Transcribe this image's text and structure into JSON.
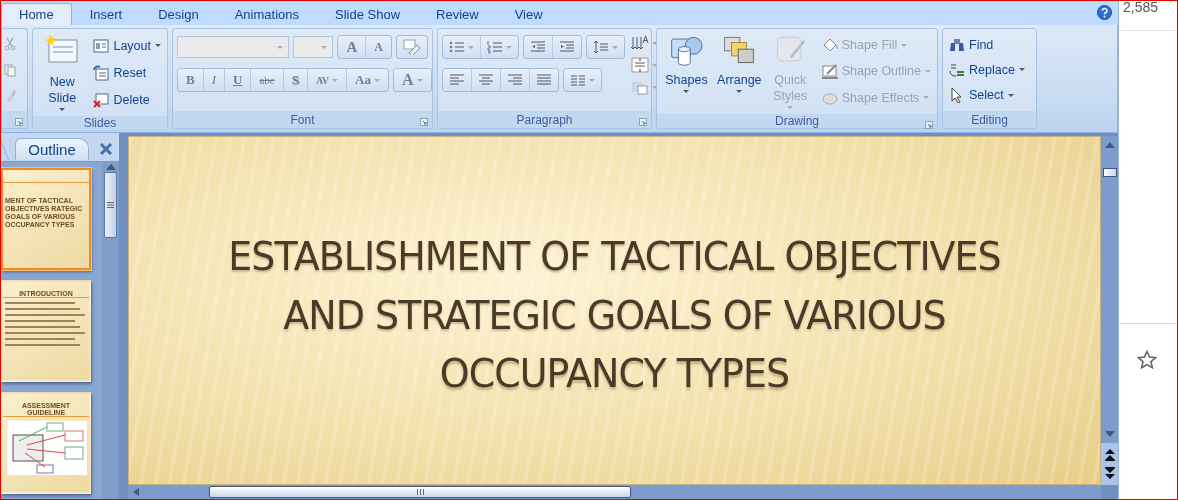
{
  "ribbon_tabs": [
    {
      "label": "Home",
      "selected": true
    },
    {
      "label": "Insert",
      "selected": false
    },
    {
      "label": "Design",
      "selected": false
    },
    {
      "label": "Animations",
      "selected": false
    },
    {
      "label": "Slide Show",
      "selected": false
    },
    {
      "label": "Review",
      "selected": false
    },
    {
      "label": "View",
      "selected": false
    }
  ],
  "slides_group": {
    "label": "Slides",
    "new_slide": "New Slide",
    "commands": [
      "Layout",
      "Reset",
      "Delete"
    ]
  },
  "font_group": {
    "label": "Font",
    "size_buttons": [
      "A",
      "A"
    ],
    "format_buttons": [
      {
        "kind": "bold",
        "label": "B"
      },
      {
        "kind": "italic",
        "label": "I"
      },
      {
        "kind": "underline",
        "label": "U"
      },
      {
        "kind": "strike",
        "label": "abc"
      },
      {
        "kind": "shadow",
        "label": "S"
      },
      {
        "kind": "spacing",
        "label": "AV"
      },
      {
        "kind": "case",
        "label": "Aa"
      }
    ],
    "color_button": "A"
  },
  "paragraph_group": {
    "label": "Paragraph"
  },
  "drawing_group": {
    "label": "Drawing",
    "buttons": [
      {
        "label": "Shapes",
        "disabled": false
      },
      {
        "label": "Arrange",
        "disabled": false
      },
      {
        "label": "Quick Styles",
        "disabled": true
      }
    ],
    "shape_commands": [
      {
        "label": "Shape Fill",
        "disabled": true
      },
      {
        "label": "Shape Outline",
        "disabled": true
      },
      {
        "label": "Shape Effects",
        "disabled": true
      }
    ]
  },
  "editing_group": {
    "label": "Editing",
    "commands": [
      "Find",
      "Replace",
      "Select"
    ]
  },
  "outline_pane": {
    "tab": "Outline",
    "thumbnails": [
      {
        "kind": "title",
        "title": "MENT OF TACTICAL OBJECTIVES RATEGIC GOALS OF VARIOUS OCCUPANCY TYPES",
        "selected": true
      },
      {
        "kind": "text",
        "title": "INTRODUCTION",
        "selected": false
      },
      {
        "kind": "diagram",
        "title": "ASSESSMENT GUIDELINE",
        "selected": false
      }
    ]
  },
  "slide": {
    "title": "ESTABLISHMENT OF TACTICAL OBJECTIVES AND STRATEGIC GOALS OF VARIOUS OCCUPANCY TYPES"
  },
  "side_page": {
    "count": "2,585"
  }
}
